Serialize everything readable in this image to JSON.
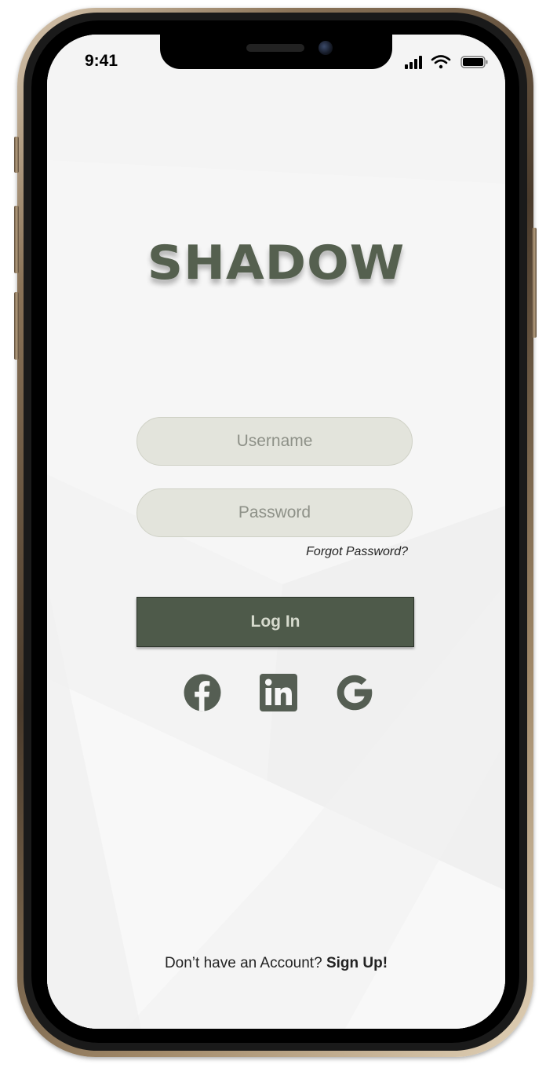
{
  "status_bar": {
    "time": "9:41",
    "icons": [
      "cellular-signal-icon",
      "wifi-icon",
      "battery-icon"
    ]
  },
  "app": {
    "logo_text": "SHADOW"
  },
  "login_form": {
    "username_placeholder": "Username",
    "password_placeholder": "Password",
    "forgot_password_label": "Forgot Password?",
    "login_button_label": "Log In"
  },
  "social_login": {
    "icons": [
      "facebook-icon",
      "linkedin-icon",
      "google-icon"
    ]
  },
  "footer": {
    "prompt": "Don’t have an Account? ",
    "signup_label": "Sign Up!"
  },
  "colors": {
    "accent": "#4e5a4a",
    "logo": "#55604f",
    "field_background": "#e3e4dc",
    "screen_background": "#f7f7f7"
  }
}
